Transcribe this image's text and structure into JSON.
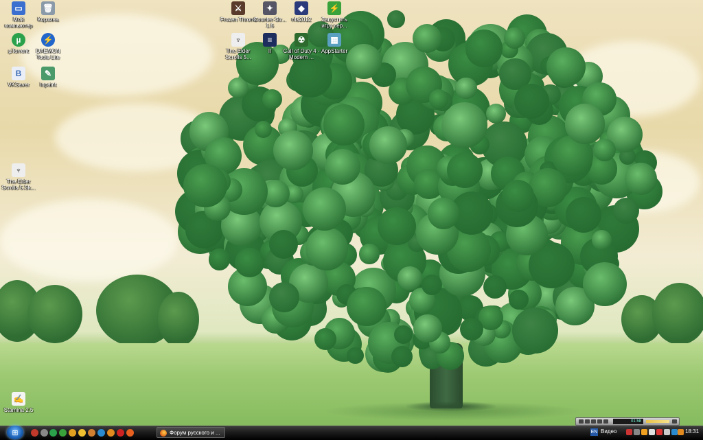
{
  "desktop_icons": [
    {
      "id": "my-computer",
      "label": "Мой компьютер",
      "color": "#3a6fd0",
      "glyph": "▭"
    },
    {
      "id": "recycle-bin",
      "label": "Корзина",
      "color": "#8a9aa8",
      "glyph": "🗑"
    },
    {
      "id": "utorrent",
      "label": "µTorrent",
      "color": "#2aa14a",
      "glyph": "µ"
    },
    {
      "id": "daemon-tools",
      "label": "DAEMON Tools Lite",
      "color": "#2266cc",
      "glyph": "⚡"
    },
    {
      "id": "vksaver",
      "label": "VKSaver",
      "color": "#3d6db5",
      "glyph": "B"
    },
    {
      "id": "inpaint",
      "label": "Inpaint",
      "color": "#4a9a6a",
      "glyph": "✎"
    },
    {
      "id": "elder-scrolls-left",
      "label": "The Elder Scrolls 5.Sk...",
      "color": "#777",
      "glyph": "♆"
    },
    {
      "id": "stamina",
      "label": "Stamina 2.5",
      "color": "#c33",
      "glyph": "✍"
    },
    {
      "id": "frozen-throne",
      "label": "Frozen Throne",
      "color": "#5a3a2a",
      "glyph": "⚔"
    },
    {
      "id": "counter-strike",
      "label": "Counter-Str... 1.6",
      "color": "#556",
      "glyph": "✦"
    },
    {
      "id": "nfs",
      "label": "nfs2012",
      "color": "#2a3a7a",
      "glyph": "◆"
    },
    {
      "id": "launch-game",
      "label": "Запустить игру сер...",
      "color": "#3aa23a",
      "glyph": "⚡"
    },
    {
      "id": "elder-scrolls-top",
      "label": "The Elder Scrolls 5...",
      "color": "#777",
      "glyph": "♆"
    },
    {
      "id": "ii",
      "label": "II",
      "color": "#1d2d5d",
      "glyph": "≡"
    },
    {
      "id": "cod",
      "label": "Call of Duty 4 - Modern ...",
      "color": "#2d6a2d",
      "glyph": "☢"
    },
    {
      "id": "apb",
      "label": "AppStarter",
      "color": "#5aa0c0",
      "glyph": "▦"
    }
  ],
  "taskbar": {
    "start_symbol": "⊞",
    "task_button": "Форум русского и ...",
    "lang": "EN",
    "video_label": "Видео",
    "clock": "18:31"
  },
  "media_player": {
    "time": "01:58"
  }
}
